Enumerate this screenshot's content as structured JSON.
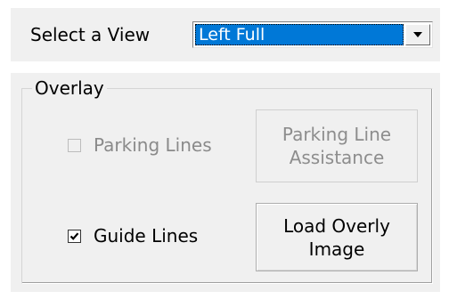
{
  "view": {
    "label": "Select a View",
    "selected": "Left Full"
  },
  "overlay": {
    "title": "Overlay",
    "parking_lines": {
      "label": "Parking Lines",
      "checked": false,
      "enabled": false
    },
    "parking_line_assistance": {
      "label": "Parking Line\nAssistance",
      "enabled": false
    },
    "guide_lines": {
      "label": "Guide Lines",
      "checked": true,
      "enabled": true
    },
    "load_overly_image": {
      "label": "Load Overly\nImage",
      "enabled": true
    }
  },
  "icons": {
    "dropdown_arrow": "chevron-down-icon",
    "checkmark": "checkmark-icon"
  }
}
